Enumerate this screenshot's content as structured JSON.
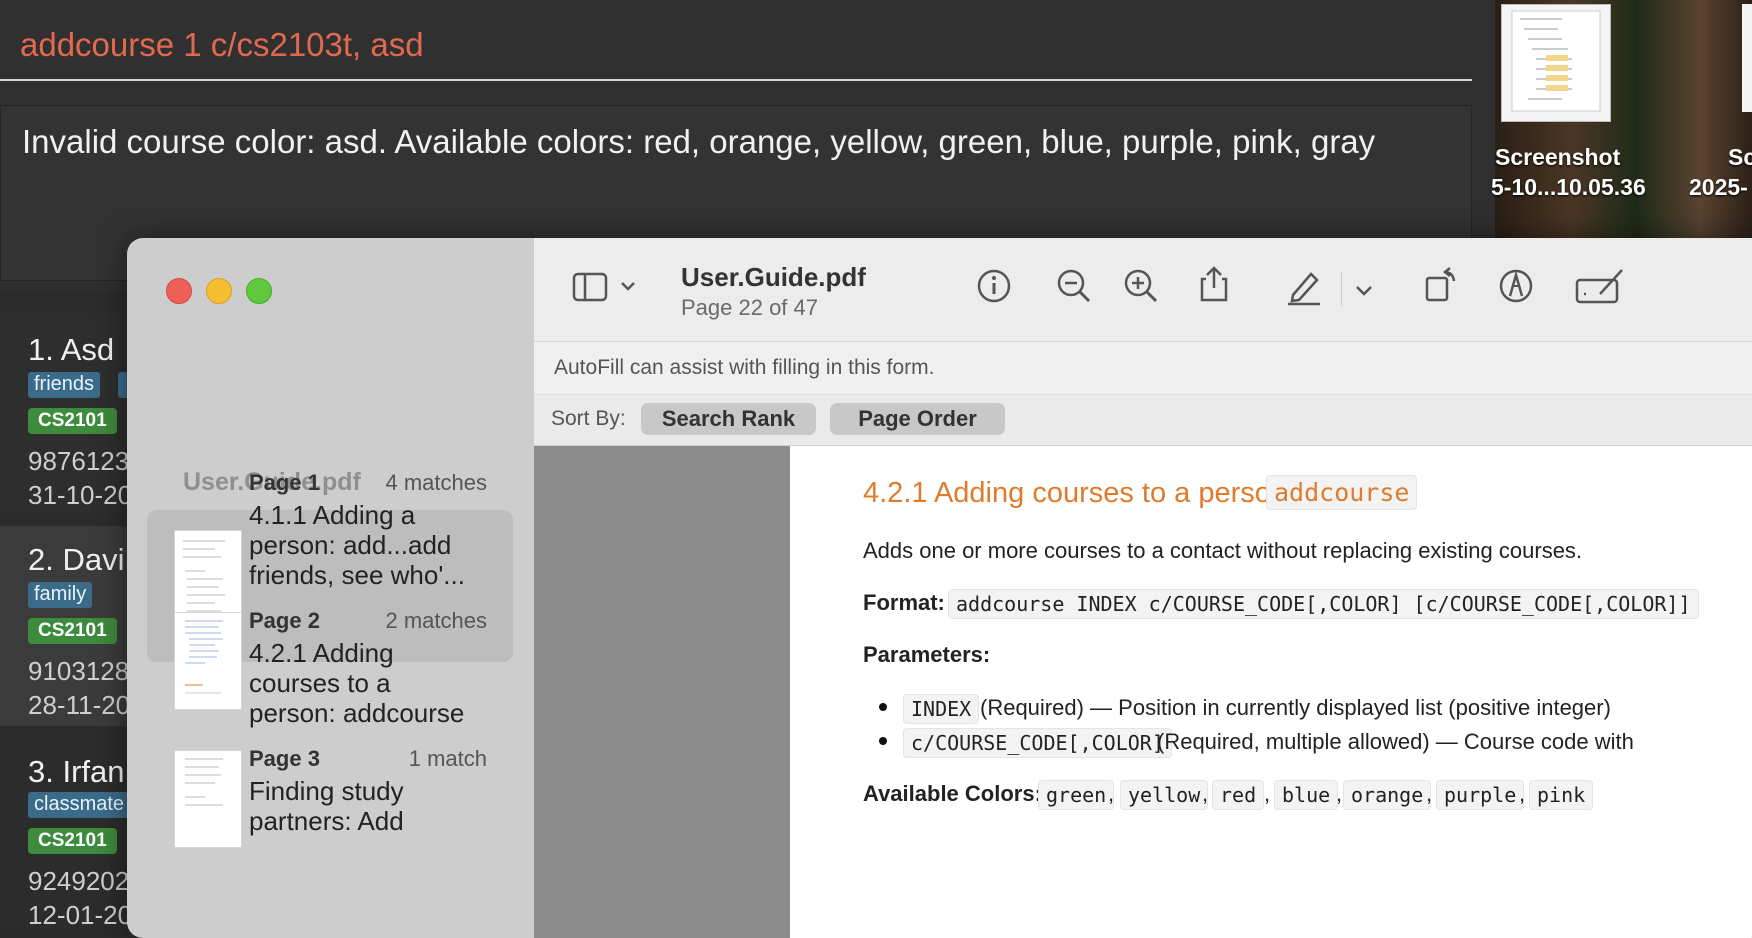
{
  "terminal": {
    "command": "addcourse 1 c/cs2103t, asd",
    "result": "Invalid course color: asd. Available colors: red, orange, yellow, green, blue, purple, pink, gray"
  },
  "persons": [
    {
      "name": "1. Asd",
      "tag": "friends",
      "course": "CS2101",
      "phone": "9876123",
      "date": "31-10-20"
    },
    {
      "name": "2. Davi",
      "tag": "family",
      "course": "CS2101",
      "phone": "9103128",
      "date": "28-11-20"
    },
    {
      "name": "3. Irfan",
      "tag": "classmate",
      "course": "CS2101",
      "phone": "9249202",
      "date": "12-01-20"
    }
  ],
  "desktop": {
    "icons": [
      {
        "label_line1": "Screenshot",
        "label_line2": "5-10...10.05.36"
      },
      {
        "label_line1": "Sc",
        "label_line2": "2025-"
      }
    ]
  },
  "preview": {
    "file_name": "User.Guide.pdf",
    "page_indicator": "Page 22 of 47",
    "autofill": "AutoFill can assist with filling in this form.",
    "sort_label": "Sort By:",
    "sort_options": [
      "Search Rank",
      "Page Order"
    ],
    "sidebar_title": "User.Guide.pdf",
    "results": [
      {
        "page": "Page 1",
        "count": "4 matches",
        "line1": "4.1.1 Adding a",
        "line2": "person: add...add",
        "line3": "friends, see who'..."
      },
      {
        "page": "Page 2",
        "count": "2 matches",
        "line1": "4.2.1 Adding",
        "line2": "courses to a",
        "line3": "person: addcourse"
      },
      {
        "page": "Page 3",
        "count": "1 match",
        "line1": "Finding study",
        "line2": "partners: Add",
        "line3": ""
      }
    ],
    "doc": {
      "heading": "4.2.1 Adding courses to a person:",
      "heading_code": "addcourse",
      "description": "Adds one or more courses to a contact without replacing existing courses.",
      "format_label": "Format:",
      "format_code": "addcourse INDEX c/COURSE_CODE[,COLOR] [c/COURSE_CODE[,COLOR]]",
      "params_label": "Parameters:",
      "params": [
        {
          "code": "INDEX",
          "text": "(Required) — Position in currently displayed list (positive integer)"
        },
        {
          "code": "c/COURSE_CODE[,COLOR]",
          "text": "(Required, multiple allowed) — Course code with"
        }
      ],
      "colors_label": "Available Colors:",
      "colors": [
        "green",
        "yellow",
        "red",
        "blue",
        "orange",
        "purple",
        "pink"
      ]
    }
  },
  "theme": {
    "accent": "#e07b2c",
    "error": "#e2694f",
    "tag": "#3a6c8a",
    "course": "#3d8b3d"
  }
}
